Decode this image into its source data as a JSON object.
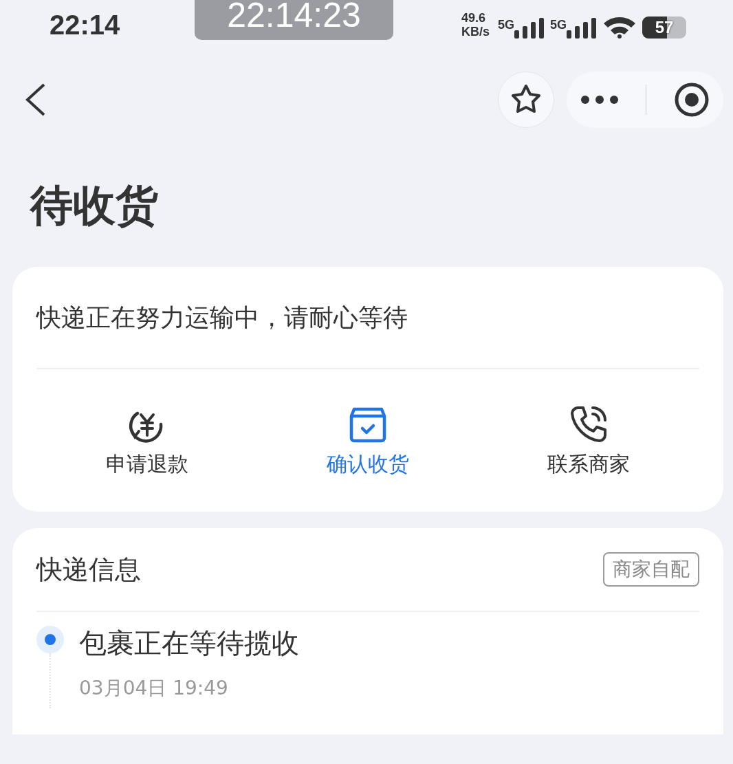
{
  "status_bar": {
    "time": "22:14",
    "recording_timer": "22:14:23",
    "net_speed": "49.6",
    "net_unit": "KB/s",
    "signals": [
      {
        "label": "5G"
      },
      {
        "label": "5G"
      }
    ],
    "battery": "57"
  },
  "nav": {
    "favorited": false
  },
  "title": "待收货",
  "status_card": {
    "message": "快递正在努力运输中，请耐心等待",
    "actions": [
      {
        "kind": "refund",
        "label": "申请退款",
        "highlighted": false
      },
      {
        "kind": "confirm",
        "label": "确认收货",
        "highlighted": true
      },
      {
        "kind": "contact",
        "label": "联系商家",
        "highlighted": false
      }
    ]
  },
  "delivery_card": {
    "title": "快递信息",
    "tag": "商家自配",
    "events": [
      {
        "text": "包裹正在等待揽收",
        "time": "03月04日 19:49",
        "active": true
      }
    ]
  }
}
